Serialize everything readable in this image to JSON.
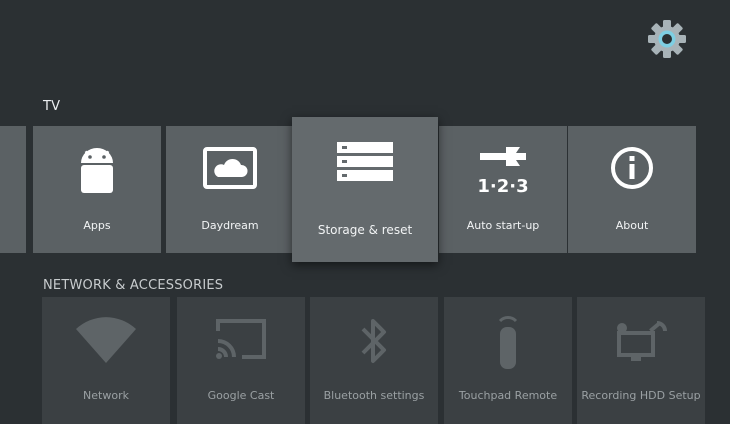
{
  "colors": {
    "background": "#2b3033",
    "tile": "#5b6164",
    "tile_focused": "#646a6d",
    "tile_dimmed": "#3b4043",
    "gear_ring": "#7ecfe3",
    "gear_body": "#a8b3b8"
  },
  "header": {
    "settings_icon": "gear-icon"
  },
  "tv_section": {
    "title": "TV",
    "items": [
      {
        "label": "Apps",
        "icon": "android-icon"
      },
      {
        "label": "Daydream",
        "icon": "daydream-icon"
      },
      {
        "label": "Storage & reset",
        "icon": "storage-icon",
        "focused": true
      },
      {
        "label": "Auto start-up",
        "icon": "wrench-123-icon"
      },
      {
        "label": "About",
        "icon": "info-icon"
      }
    ]
  },
  "network_section": {
    "title": "NETWORK & ACCESSORIES",
    "items": [
      {
        "label": "Network",
        "icon": "wifi-icon"
      },
      {
        "label": "Google Cast",
        "icon": "cast-icon"
      },
      {
        "label": "Bluetooth settings",
        "icon": "bluetooth-icon"
      },
      {
        "label": "Touchpad Remote",
        "icon": "remote-icon"
      },
      {
        "label": "Recording HDD Setup",
        "icon": "tv-record-icon"
      }
    ]
  }
}
